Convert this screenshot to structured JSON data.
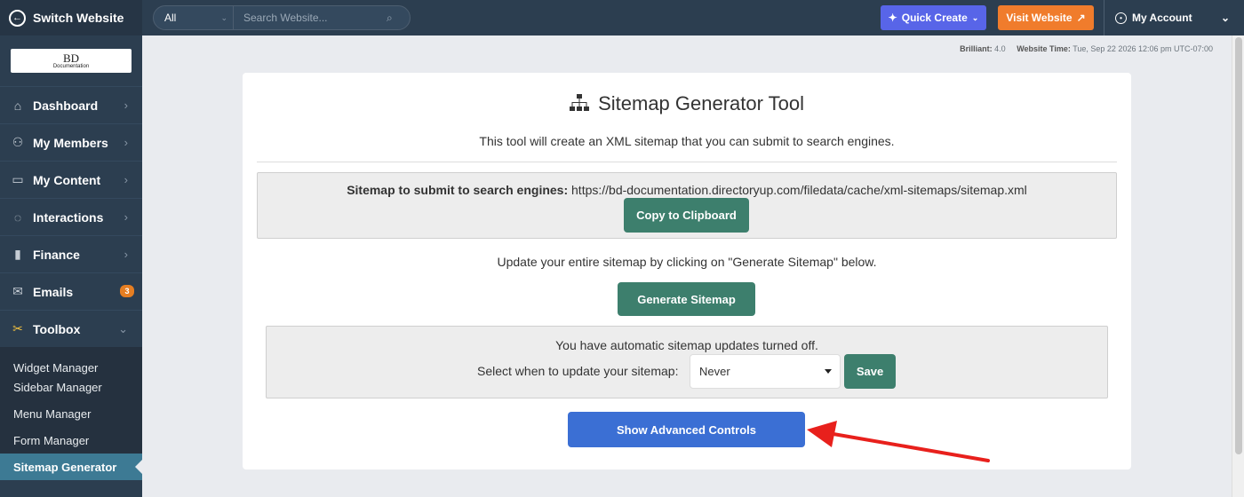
{
  "sidebar": {
    "switch_label": "Switch Website",
    "logo_text": "BD",
    "logo_sub": "Documentation",
    "items": [
      {
        "label": "Dashboard"
      },
      {
        "label": "My Members"
      },
      {
        "label": "My Content"
      },
      {
        "label": "Interactions"
      },
      {
        "label": "Finance"
      },
      {
        "label": "Emails",
        "badge": "3"
      },
      {
        "label": "Toolbox"
      }
    ],
    "sub_items": [
      {
        "label": "Widget Manager"
      },
      {
        "label": "Sidebar Manager"
      },
      {
        "label": "Menu Manager"
      },
      {
        "label": "Form Manager"
      },
      {
        "label": "Sitemap Generator"
      }
    ]
  },
  "topbar": {
    "search_scope": "All",
    "search_placeholder": "Search Website...",
    "quick_create": "Quick Create",
    "visit_website": "Visit Website",
    "account": "My Account"
  },
  "info": {
    "brilliant_label": "Brilliant:",
    "brilliant_value": "4.0",
    "time_label": "Website Time:",
    "time_value": "Tue, Sep 22 2026 12:06 pm UTC-07:00"
  },
  "main": {
    "title": "Sitemap Generator Tool",
    "description": "This tool will create an XML sitemap that you can submit to search engines.",
    "sitemap_label": "Sitemap to submit to search engines:",
    "sitemap_url": "https://bd-documentation.directoryup.com/filedata/cache/xml-sitemaps/sitemap.xml",
    "copy_button": "Copy to Clipboard",
    "update_text": "Update your entire sitemap by clicking on \"Generate Sitemap\" below.",
    "generate_button": "Generate Sitemap",
    "auto_text": "You have automatic sitemap updates turned off.",
    "select_label": "Select when to update your sitemap:",
    "select_value": "Never",
    "save_button": "Save",
    "advanced_button": "Show Advanced Controls"
  },
  "colors": {
    "sidebar_bg": "#2c3e50",
    "green_button": "#3d7f6d",
    "blue_button": "#3b6fd4",
    "quick_create": "#5865e8",
    "visit_website": "#f07c2c",
    "annotation_arrow": "#e8201c"
  },
  "icons": [
    "switch-arrow-icon",
    "home-icon",
    "members-icon",
    "folder-icon",
    "chat-icon",
    "chart-icon",
    "envelope-icon",
    "tools-icon",
    "search-icon",
    "sparkle-icon",
    "external-link-icon",
    "user-icon",
    "sitemap-icon"
  ]
}
